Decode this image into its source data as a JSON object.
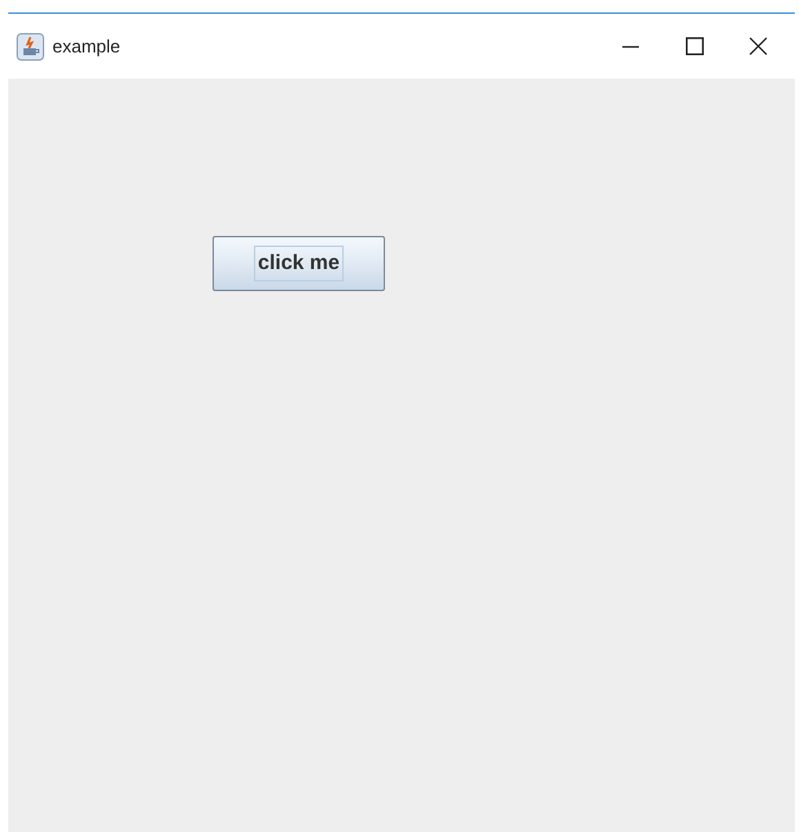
{
  "window": {
    "title": "example",
    "controls": [
      {
        "kind": "minimize"
      },
      {
        "kind": "maximize"
      },
      {
        "kind": "close"
      }
    ]
  },
  "button": {
    "label": "click me",
    "focused": true
  }
}
